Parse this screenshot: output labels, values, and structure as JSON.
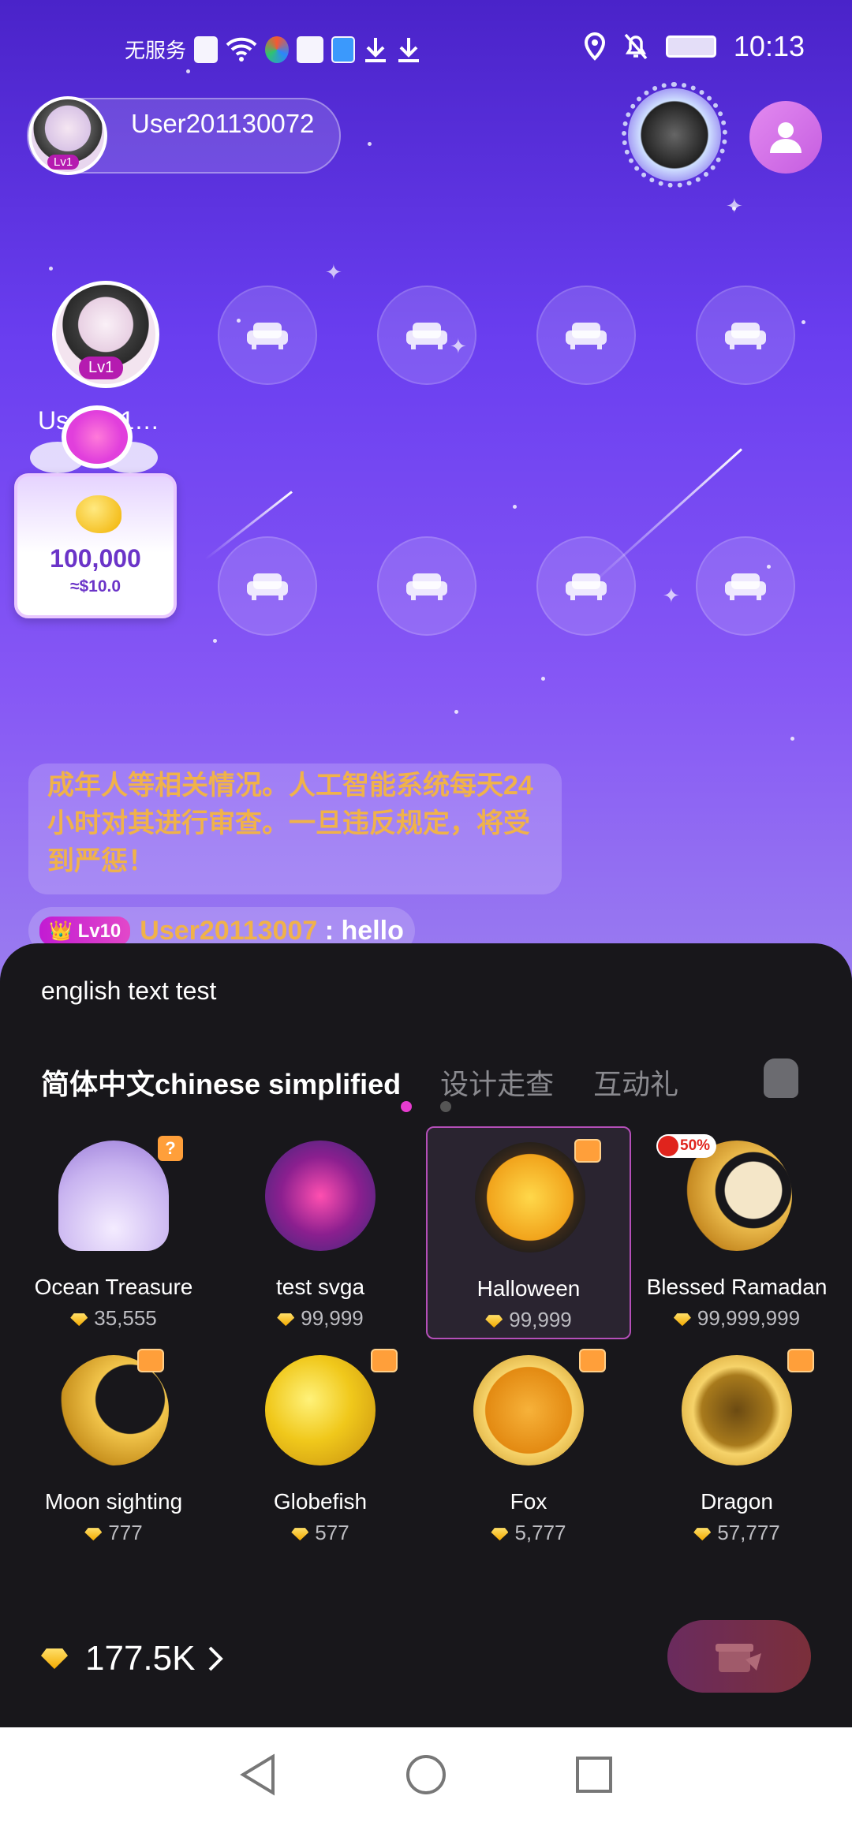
{
  "status_bar": {
    "carrier": "无服务",
    "time": "10:13",
    "icons": [
      "sim-alert-icon",
      "wifi-icon",
      "browser-icon",
      "huawei-icon",
      "globe-icon",
      "download-icon",
      "download-icon",
      "location-icon",
      "bell-off-icon",
      "battery-icon"
    ]
  },
  "room": {
    "owner": {
      "name": "User201130072",
      "level": "Lv1"
    },
    "host": {
      "name": "Us…011…",
      "level": "Lv1"
    },
    "seats": {
      "empty_count": 8,
      "icon": "sofa-icon"
    },
    "bean_card": {
      "amount": "100,000",
      "usd": "≈$10.0"
    },
    "notice": "成年人等相关情况。人工智能系统每天24 小时对其进行审查。一旦违反规定，将受到严惩！",
    "chat": {
      "level": "Lv10",
      "user": "User20113007",
      "separator": " : ",
      "message": "hello"
    }
  },
  "gift_panel": {
    "header_text": "english text test",
    "tabs": [
      {
        "label": "简体中文chinese simplified",
        "active": true
      },
      {
        "label": "设计走查",
        "active": false
      },
      {
        "label": "互动礼",
        "active": false
      }
    ],
    "gifts": [
      {
        "name": "Ocean Treasure",
        "price": "35,555",
        "badge": "?"
      },
      {
        "name": "test svga",
        "price": "99,999"
      },
      {
        "name": "Halloween",
        "price": "99,999",
        "selected": true
      },
      {
        "name": "Blessed Ramadan",
        "price": "99,999,999",
        "badge": "50%"
      },
      {
        "name": "Moon sighting",
        "price": "777"
      },
      {
        "name": "Globefish",
        "price": "577"
      },
      {
        "name": "Fox",
        "price": "5,777"
      },
      {
        "name": "Dragon",
        "price": "57,777"
      }
    ],
    "page": {
      "current": 1,
      "total": 2
    },
    "balance": "177.5K",
    "colors": {
      "accent": "#e63ccf",
      "gold": "#f0b24a",
      "panel_bg": "#18171b"
    }
  }
}
